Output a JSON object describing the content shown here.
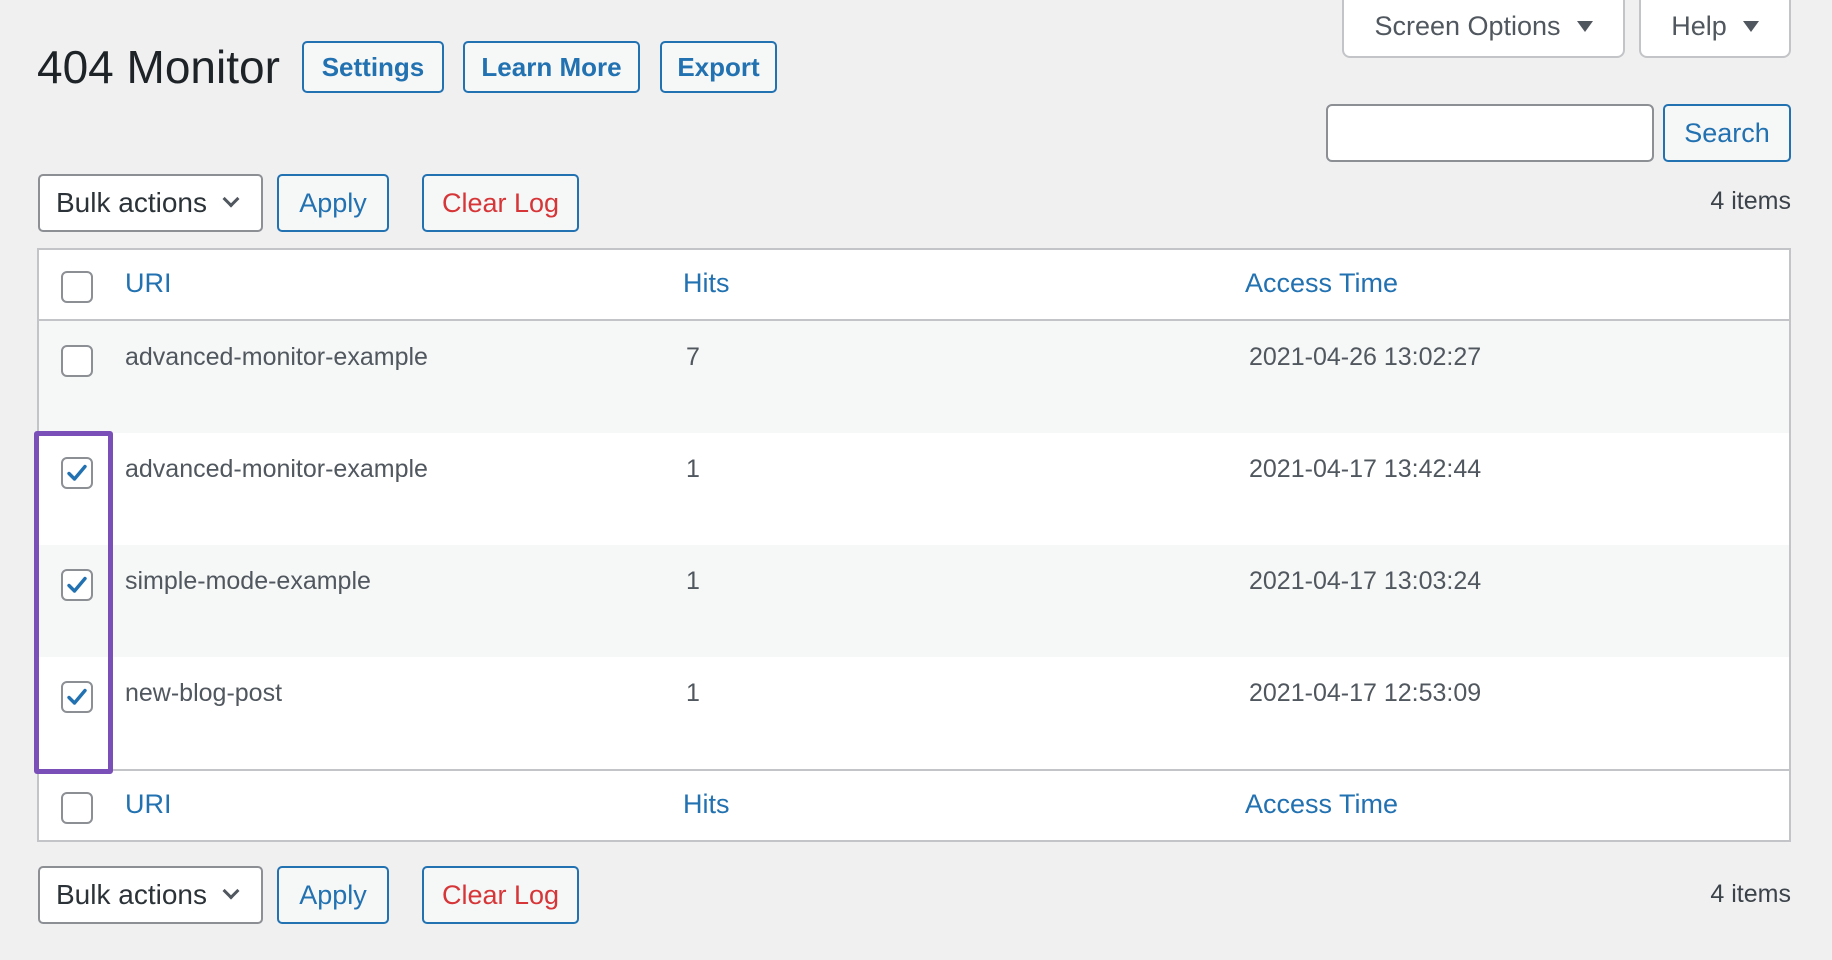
{
  "header": {
    "title": "404 Monitor",
    "buttons": {
      "settings": "Settings",
      "learn_more": "Learn More",
      "export": "Export"
    }
  },
  "screen_meta": {
    "screen_options": "Screen Options",
    "help": "Help"
  },
  "search": {
    "value": "",
    "placeholder": "",
    "button": "Search"
  },
  "tablenav_top": {
    "bulk_actions": "Bulk actions",
    "apply": "Apply",
    "clear_log": "Clear Log",
    "count": "4 items"
  },
  "tablenav_bottom": {
    "bulk_actions": "Bulk actions",
    "apply": "Apply",
    "clear_log": "Clear Log",
    "count": "4 items"
  },
  "table": {
    "columns": [
      "URI",
      "Hits",
      "Access Time"
    ],
    "rows": [
      {
        "uri": "advanced-monitor-example",
        "hits": "7",
        "access_time": "2021-04-26 13:02:27",
        "checked": false
      },
      {
        "uri": "advanced-monitor-example",
        "hits": "1",
        "access_time": "2021-04-17 13:42:44",
        "checked": true
      },
      {
        "uri": "simple-mode-example",
        "hits": "1",
        "access_time": "2021-04-17 13:03:24",
        "checked": true
      },
      {
        "uri": "new-blog-post",
        "hits": "1",
        "access_time": "2021-04-17 12:53:09",
        "checked": true
      }
    ]
  },
  "colors": {
    "accent": "#2271b1",
    "danger": "#d63638",
    "highlight": "#7b4fb8",
    "background": "#f0f0f1"
  }
}
